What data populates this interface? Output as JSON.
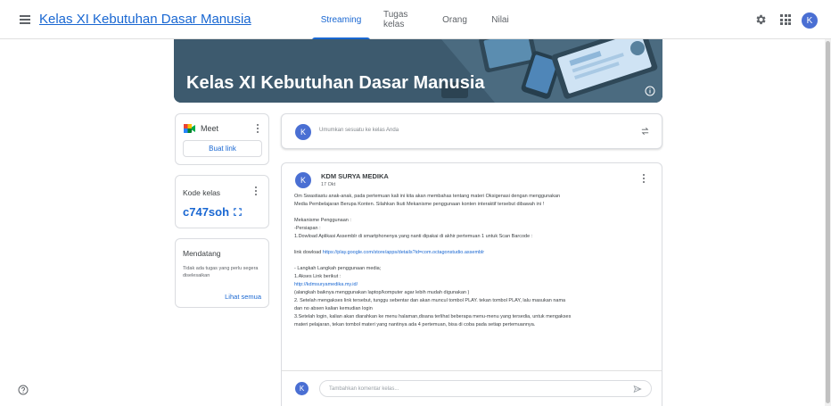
{
  "header": {
    "class_title": "Kelas XI Kebutuhan Dasar Manusia",
    "menu_icon": "hamburger-menu-icon",
    "tabs": [
      {
        "label": "Streaming",
        "active": true
      },
      {
        "label": "Tugas kelas",
        "active": false
      },
      {
        "label": "Orang",
        "active": false
      },
      {
        "label": "Nilai",
        "active": false
      }
    ],
    "settings_icon": "gear-icon",
    "apps_icon": "apps-grid-icon",
    "avatar_initial": "K"
  },
  "banner": {
    "title": "Kelas XI Kebutuhan Dasar Manusia",
    "info_icon": "info-icon"
  },
  "meet": {
    "label": "Meet",
    "button": "Buat link",
    "icon": "google-meet-icon"
  },
  "class_code": {
    "label": "Kode kelas",
    "value": "c747soh",
    "fullscreen_icon": "fullscreen-icon"
  },
  "upcoming": {
    "label": "Mendatang",
    "empty_text": "Tidak ada tugas yang perlu segera diselesaikan",
    "view_all": "Lihat semua"
  },
  "announce": {
    "avatar_initial": "K",
    "placeholder": "Umumkan sesuatu ke kelas Anda",
    "repost_icon": "repost-icon"
  },
  "post": {
    "avatar_initial": "K",
    "author": "KDM SURYA MEDIKA",
    "date": "17 Okt",
    "intro_1": "Om Swastiastu anak-anak,  pada pertemuan kali ini kita akan membahas tentang materi Oksigenasi dengan menggunakan",
    "intro_2": "Media Pembelajaran Berupa Konten. Silahkan Ikuti Mekanisme penggunaan konten interaktif tersebut dibawah ini !",
    "mekanisme": "Mekanisme Penggunaan :",
    "persiapan": "-Persiapan :",
    "step_download": "1.Dowload Aplikasi Assemblr di smartphonenya yang nanti dipakai di akhir pertemuan 1 untuk Scan Barcode  :",
    "link_label": "link dowload ",
    "link_url": "https://play.google.com/store/apps/details?id=com.octagonstudio.assemblr",
    "langkah": "- Langkah Langkah penggunaan media;",
    "akses": "1.Akses Link berikut :",
    "site_url": "http://kdmsuryamedika.my.id/",
    "saran": "(alangkah baiknya menggunakan laptop/komputer agar lebih mudah digunakan )",
    "step2a": "2. Setelah mengakses link tersebut, tunggu sebentar dan akan muncul tombol PLAY. tekan tombol PLAY, lalu masukan nama",
    "step2b": "dan no absen kalian kemudian login",
    "step3a": "3.Setelah login, kalian akan diarahkan ke menu halaman,disana terlihat beberapa menu-menu yang tersedia, untuk mengakses",
    "step3b": "materi pelajaran, tekan tombol materi yang nantinya ada 4 pertemuan, bisa di coba pada setiap pertemuannya.",
    "comment_avatar_initial": "K",
    "comment_placeholder": "Tambahkan komentar kelas...",
    "send_icon": "send-icon"
  },
  "footer": {
    "help_icon": "help-icon"
  },
  "colors": {
    "accent": "#1967d2",
    "avatar": "#4a6fd3",
    "banner": "#3d5a6e"
  }
}
